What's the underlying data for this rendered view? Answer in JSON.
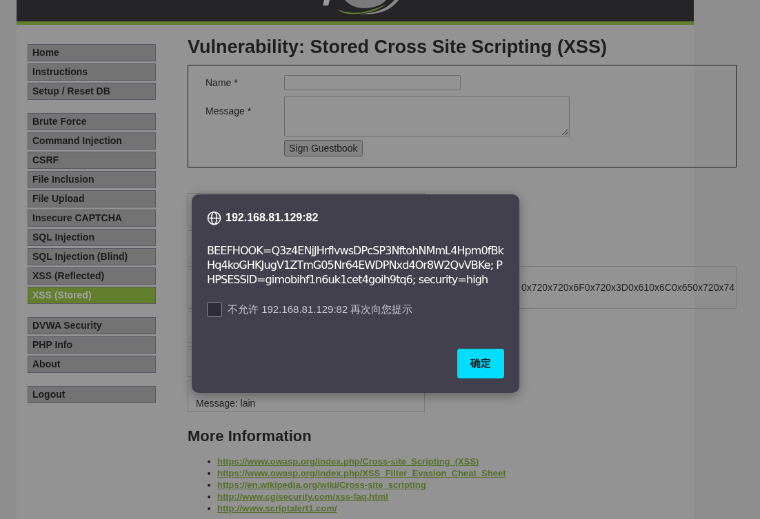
{
  "sidebar": {
    "groups": [
      [
        {
          "label": "Home",
          "selected": false
        },
        {
          "label": "Instructions",
          "selected": false
        },
        {
          "label": "Setup / Reset DB",
          "selected": false
        }
      ],
      [
        {
          "label": "Brute Force",
          "selected": false
        },
        {
          "label": "Command Injection",
          "selected": false
        },
        {
          "label": "CSRF",
          "selected": false
        },
        {
          "label": "File Inclusion",
          "selected": false
        },
        {
          "label": "File Upload",
          "selected": false
        },
        {
          "label": "Insecure CAPTCHA",
          "selected": false
        },
        {
          "label": "SQL Injection",
          "selected": false
        },
        {
          "label": "SQL Injection (Blind)",
          "selected": false
        },
        {
          "label": "XSS (Reflected)",
          "selected": false
        },
        {
          "label": "XSS (Stored)",
          "selected": true
        }
      ],
      [
        {
          "label": "DVWA Security",
          "selected": false
        },
        {
          "label": "PHP Info",
          "selected": false
        },
        {
          "label": "About",
          "selected": false
        }
      ],
      [
        {
          "label": "Logout",
          "selected": false
        }
      ]
    ]
  },
  "title": "Vulnerability: Stored Cross Site Scripting (XSS)",
  "form": {
    "name_label": "Name *",
    "message_label": "Message *",
    "submit": "Sign Guestbook"
  },
  "guestbook": [
    {
      "kind": "covered"
    },
    {
      "kind": "covered"
    },
    {
      "kind": "text",
      "lines": [
        "0x720x720x6F0x720x3D0x610x6C0x650x720x74"
      ]
    },
    {
      "kind": "covered"
    },
    {
      "kind": "covered"
    },
    {
      "kind": "text",
      "lines": [
        "Message: lain"
      ]
    }
  ],
  "more_info": {
    "heading": "More Information",
    "links": [
      "https://www.owasp.org/index.php/Cross-site_Scripting_(XSS)",
      "https://www.owasp.org/index.php/XSS_Filter_Evasion_Cheat_Sheet",
      "https://en.wikipedia.org/wiki/Cross-site_scripting",
      "http://www.cgisecurity.com/xss-faq.html",
      "http://www.scriptalert1.com/"
    ]
  },
  "dialog": {
    "host": "192.168.81.129:82",
    "message": "BEEFHOOK=Q3z4ENjJHrflvwsDPcSP3NftohNMmL4Hpm0fBkHq4koGHKJugV1ZTmG05Nr64EWDPNxd4Or8W2QvVBKe; PHPSESSID=gimobihf1n6uk1cet4goih9tq6; security=high",
    "checkbox": {
      "label": "不允许 192.168.81.129:82 再次向您提示",
      "checked": false
    },
    "ok_button": "确定"
  }
}
